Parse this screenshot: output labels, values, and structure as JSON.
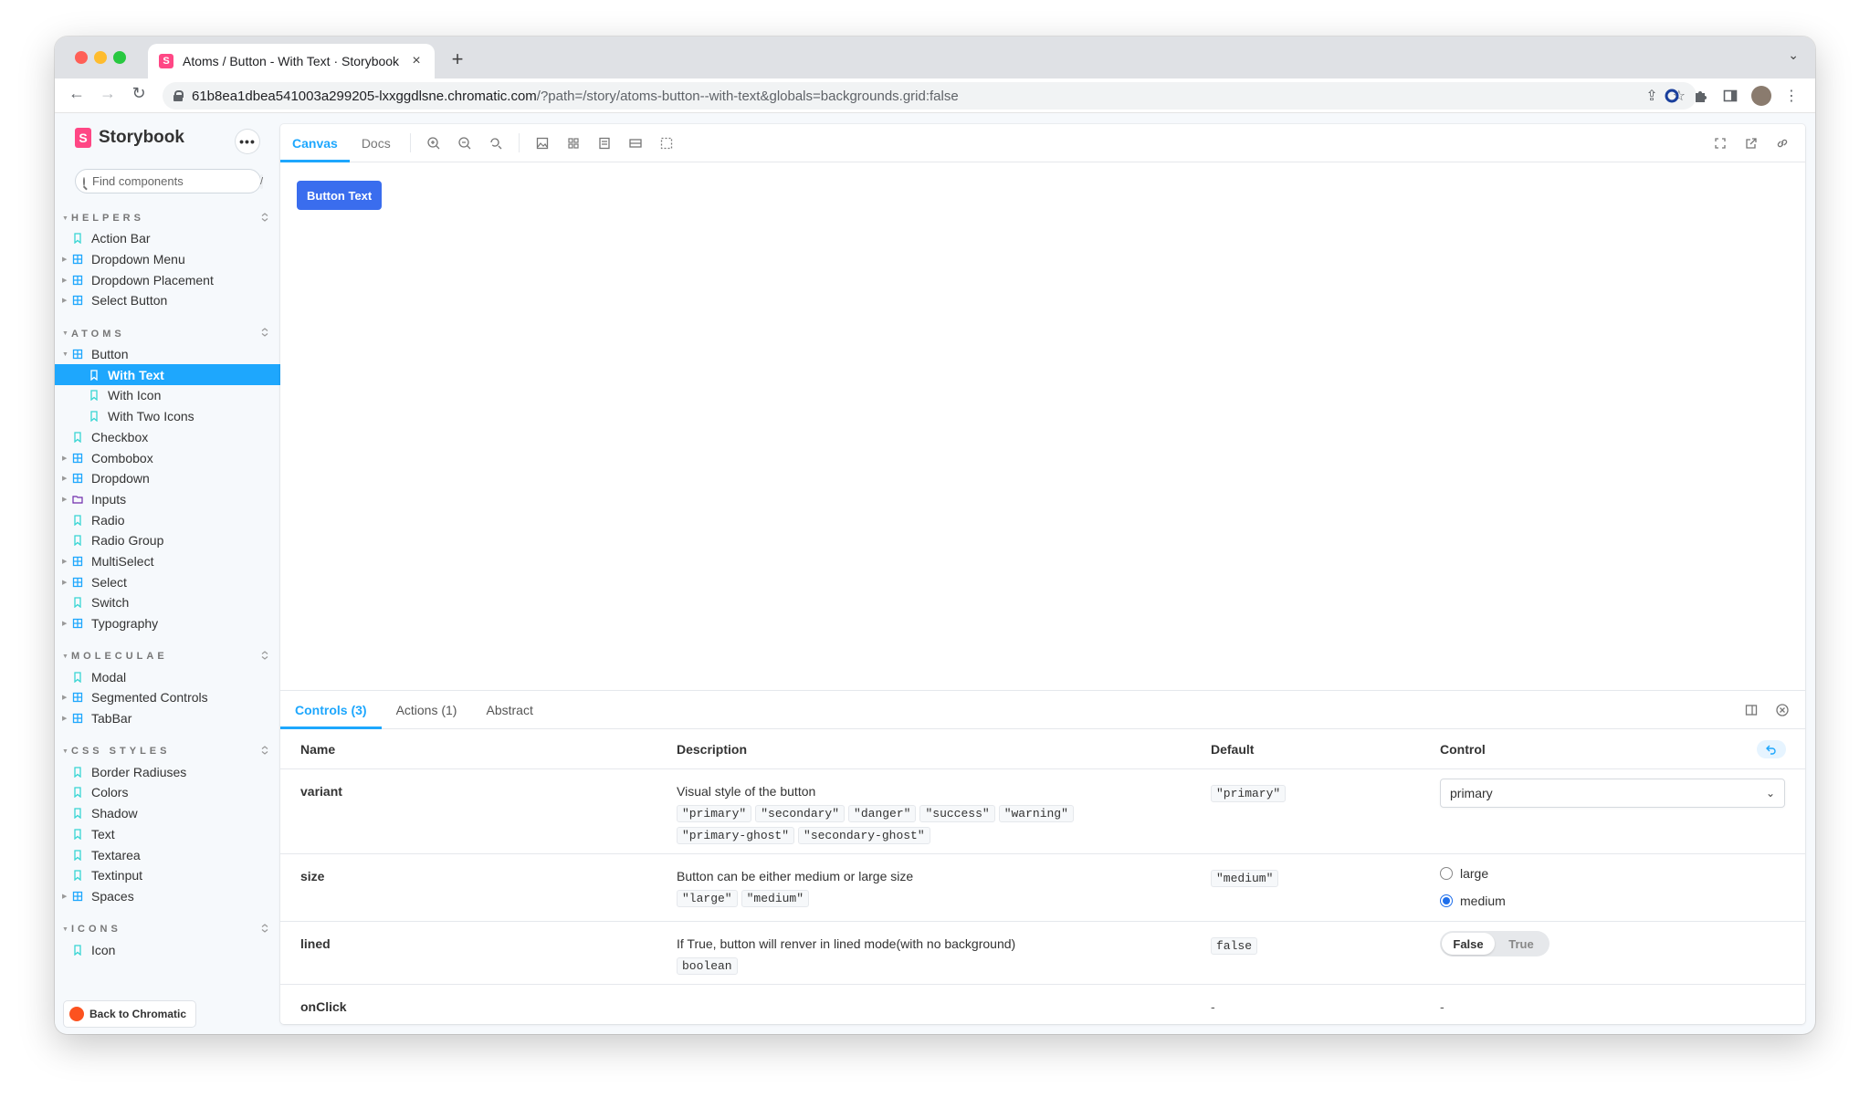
{
  "browser": {
    "tab_title": "Atoms / Button - With Text · Storybook",
    "url_host": "61b8ea1dbea541003a299205-lxxggdlsne.chromatic.com",
    "url_path": "/?path=/story/atoms-button--with-text&globals=backgrounds.grid:false"
  },
  "sidebar": {
    "brand": "Storybook",
    "more": "•••",
    "search_placeholder": "Find components",
    "search_shortcut": "/",
    "back_label": "Back to Chromatic",
    "groups": [
      {
        "title": "HELPERS",
        "items": [
          {
            "label": "Action Bar",
            "type": "story",
            "depth": 0,
            "expandable": false
          },
          {
            "label": "Dropdown Menu",
            "type": "component",
            "depth": 0,
            "expandable": true
          },
          {
            "label": "Dropdown Placement",
            "type": "component",
            "depth": 0,
            "expandable": true
          },
          {
            "label": "Select Button",
            "type": "component",
            "depth": 0,
            "expandable": true
          }
        ]
      },
      {
        "title": "ATOMS",
        "items": [
          {
            "label": "Button",
            "type": "component",
            "depth": 0,
            "expandable": true,
            "expanded": true
          },
          {
            "label": "With Text",
            "type": "story",
            "depth": 1,
            "expandable": false,
            "selected": true
          },
          {
            "label": "With Icon",
            "type": "story",
            "depth": 1,
            "expandable": false
          },
          {
            "label": "With Two Icons",
            "type": "story",
            "depth": 1,
            "expandable": false
          },
          {
            "label": "Checkbox",
            "type": "story",
            "depth": 0,
            "expandable": false
          },
          {
            "label": "Combobox",
            "type": "component",
            "depth": 0,
            "expandable": true
          },
          {
            "label": "Dropdown",
            "type": "component",
            "depth": 0,
            "expandable": true
          },
          {
            "label": "Inputs",
            "type": "folder",
            "depth": 0,
            "expandable": true
          },
          {
            "label": "Radio",
            "type": "story",
            "depth": 0,
            "expandable": false
          },
          {
            "label": "Radio Group",
            "type": "story",
            "depth": 0,
            "expandable": false
          },
          {
            "label": "MultiSelect",
            "type": "component",
            "depth": 0,
            "expandable": true
          },
          {
            "label": "Select",
            "type": "component",
            "depth": 0,
            "expandable": true
          },
          {
            "label": "Switch",
            "type": "story",
            "depth": 0,
            "expandable": false
          },
          {
            "label": "Typography",
            "type": "component",
            "depth": 0,
            "expandable": true
          }
        ]
      },
      {
        "title": "MOLECULAE",
        "items": [
          {
            "label": "Modal",
            "type": "story",
            "depth": 0,
            "expandable": false
          },
          {
            "label": "Segmented Controls",
            "type": "component",
            "depth": 0,
            "expandable": true
          },
          {
            "label": "TabBar",
            "type": "component",
            "depth": 0,
            "expandable": true
          }
        ]
      },
      {
        "title": "CSS STYLES",
        "items": [
          {
            "label": "Border Radiuses",
            "type": "story",
            "depth": 0,
            "expandable": false
          },
          {
            "label": "Colors",
            "type": "story",
            "depth": 0,
            "expandable": false
          },
          {
            "label": "Shadow",
            "type": "story",
            "depth": 0,
            "expandable": false
          },
          {
            "label": "Text",
            "type": "story",
            "depth": 0,
            "expandable": false
          },
          {
            "label": "Textarea",
            "type": "story",
            "depth": 0,
            "expandable": false
          },
          {
            "label": "Textinput",
            "type": "story",
            "depth": 0,
            "expandable": false
          },
          {
            "label": "Spaces",
            "type": "component",
            "depth": 0,
            "expandable": true
          }
        ]
      },
      {
        "title": "ICONS",
        "items": [
          {
            "label": "Icon",
            "type": "story",
            "depth": 0,
            "expandable": false
          }
        ]
      }
    ]
  },
  "toolbar": {
    "tabs": [
      "Canvas",
      "Docs"
    ],
    "active_tab": "Canvas"
  },
  "canvas": {
    "button_label": "Button Text",
    "button_color": "#3a6dee"
  },
  "addons": {
    "tabs": [
      "Controls (3)",
      "Actions (1)",
      "Abstract"
    ],
    "active_tab": "Controls (3)",
    "columns": {
      "name": "Name",
      "description": "Description",
      "default": "Default",
      "control": "Control"
    },
    "rows": {
      "variant": {
        "name": "variant",
        "description": "Visual style of the button",
        "options": [
          "\"primary\"",
          "\"secondary\"",
          "\"danger\"",
          "\"success\"",
          "\"warning\"",
          "\"primary-ghost\"",
          "\"secondary-ghost\""
        ],
        "default": "\"primary\"",
        "value": "primary"
      },
      "size": {
        "name": "size",
        "description": "Button can be either medium or large size",
        "options": [
          "\"large\"",
          "\"medium\""
        ],
        "default": "\"medium\"",
        "radio": [
          "large",
          "medium"
        ],
        "selected": "medium"
      },
      "lined": {
        "name": "lined",
        "description": "If True, button will renver in lined mode(with no background)",
        "type": "boolean",
        "default": "false",
        "toggle": [
          "False",
          "True"
        ],
        "selected": "False"
      },
      "onclick": {
        "name": "onClick",
        "default": "-",
        "control": "-"
      }
    }
  },
  "colors": {
    "accent": "#1ea7fd",
    "brand": "#ff4785"
  }
}
